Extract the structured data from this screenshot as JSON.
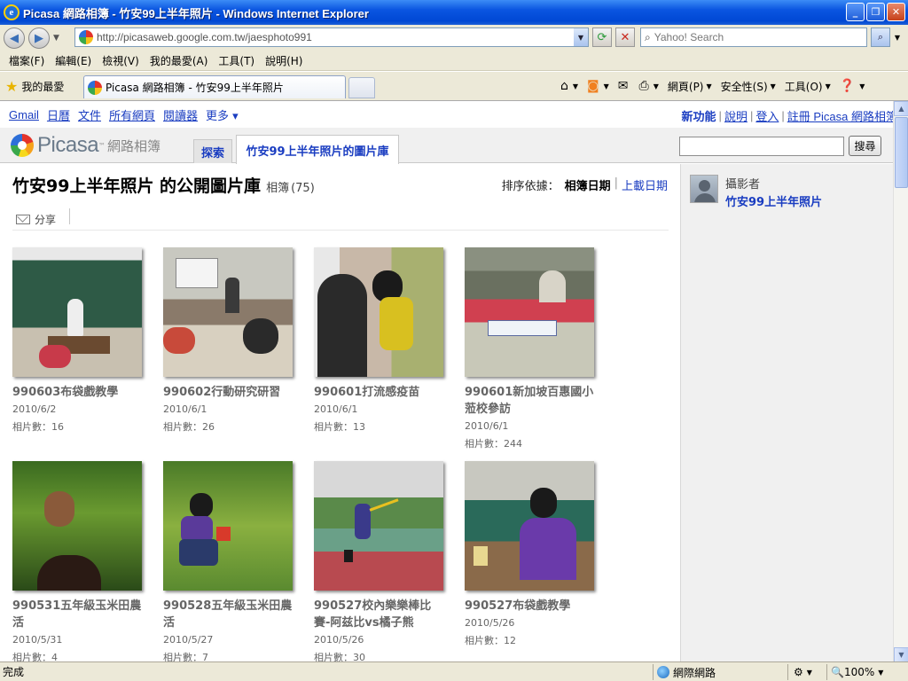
{
  "window": {
    "title": "Picasa 網路相簿 - 竹安99上半年照片 - Windows Internet Explorer",
    "app_icon": "ie-logo-icon",
    "buttons": [
      "minimize",
      "restore",
      "close"
    ]
  },
  "address": {
    "url": "http://picasaweb.google.com.tw/jaesphoto991",
    "search_placeholder": "Yahoo! Search"
  },
  "menubar": [
    "檔案(F)",
    "編輯(E)",
    "檢視(V)",
    "我的最愛(A)",
    "工具(T)",
    "說明(H)"
  ],
  "favorites": {
    "label": "我的最愛",
    "tab_title": "Picasa 網路相簿 - 竹安99上半年照片"
  },
  "commandbar": {
    "page": "網頁(P)",
    "safety": "安全性(S)",
    "tools": "工具(O)"
  },
  "gbar": {
    "links": [
      "Gmail",
      "日曆",
      "文件",
      "所有網頁",
      "閱讀器"
    ],
    "more": "更多 ▾",
    "right": {
      "whats_new": "新功能",
      "help": "說明",
      "signin": "登入",
      "register": "註冊 Picasa 網路相簿"
    }
  },
  "header": {
    "logo_word": "Picasa",
    "logo_tm": "™",
    "logo_sub": "網路相簿",
    "tab_explore": "探索",
    "tab_gallery": "竹安99上半年照片的圖片庫",
    "search_button": "搜尋"
  },
  "page": {
    "title": "竹安99上半年照片 的公開圖片庫",
    "kind": "相簿",
    "count": "(75)",
    "sort_label": "排序依據：",
    "sort_current": "相簿日期",
    "sort_alt": "上載日期",
    "share": "分享"
  },
  "owner": {
    "label": "攝影者",
    "name": "竹安99上半年照片"
  },
  "albums": [
    {
      "name": "990603布袋戲教學",
      "date": "2010/6/2",
      "count_label": "相片數：",
      "count": "16"
    },
    {
      "name": "990602行動研究研習",
      "date": "2010/6/1",
      "count_label": "相片數：",
      "count": "26"
    },
    {
      "name": "990601打流感疫苗",
      "date": "2010/6/1",
      "count_label": "相片數：",
      "count": "13"
    },
    {
      "name": "990601新加坡百惠國小蒞校參訪",
      "date": "2010/6/1",
      "count_label": "相片數：",
      "count": "244"
    },
    {
      "name": "990531五年級玉米田農活",
      "date": "2010/5/31",
      "count_label": "相片數：",
      "count": "4"
    },
    {
      "name": "990528五年級玉米田農活",
      "date": "2010/5/27",
      "count_label": "相片數：",
      "count": "7"
    },
    {
      "name": "990527校內樂樂棒比賽-阿兹比vs橘子熊",
      "date": "2010/5/26",
      "count_label": "相片數：",
      "count": "30"
    },
    {
      "name": "990527布袋戲教學",
      "date": "2010/5/26",
      "count_label": "相片數：",
      "count": "12"
    }
  ],
  "statusbar": {
    "status": "完成",
    "zone": "網際網路",
    "zoom": "100%"
  }
}
